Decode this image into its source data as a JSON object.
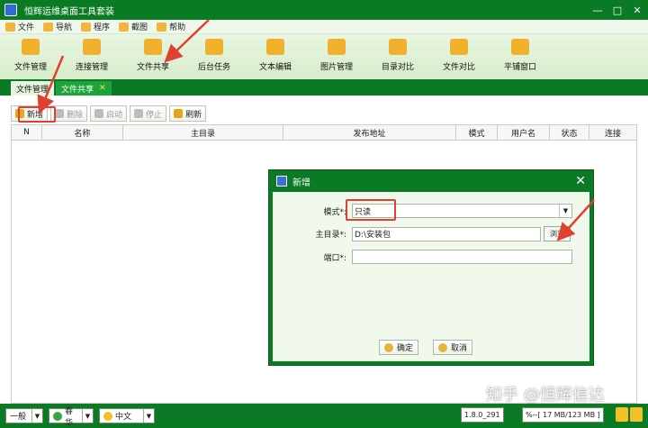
{
  "window": {
    "title": "恒辉运维桌面工具套装",
    "controls": [
      "—",
      "□",
      "✕"
    ]
  },
  "menu": [
    {
      "label": "文件",
      "icon": "file-icon"
    },
    {
      "label": "导航",
      "icon": "nav-icon"
    },
    {
      "label": "程序",
      "icon": "program-icon"
    },
    {
      "label": "截图",
      "icon": "crop-icon"
    },
    {
      "label": "帮助",
      "icon": "help-icon"
    }
  ],
  "toolbar": [
    {
      "label": "文件管理",
      "icon": "folder-icon"
    },
    {
      "label": "连接管理",
      "icon": "connect-icon"
    },
    {
      "label": "文件共享",
      "icon": "share-icon"
    },
    {
      "label": "后台任务",
      "icon": "monitor-icon"
    },
    {
      "label": "文本编辑",
      "icon": "edit-icon"
    },
    {
      "label": "图片管理",
      "icon": "image-icon"
    },
    {
      "label": "目录对比",
      "icon": "dir-compare-icon"
    },
    {
      "label": "文件对比",
      "icon": "file-compare-icon"
    },
    {
      "label": "平铺窗口",
      "icon": "tile-icon"
    }
  ],
  "tabs": [
    {
      "label": "文件管理",
      "active": false
    },
    {
      "label": "文件共享",
      "active": true,
      "close": "✕"
    }
  ],
  "actions": [
    {
      "label": "新增",
      "enabled": true,
      "color": "#e8a51c"
    },
    {
      "label": "删除",
      "enabled": false,
      "color": "#bdbdbd"
    },
    {
      "label": "启动",
      "enabled": false,
      "color": "#bdbdbd"
    },
    {
      "label": "停止",
      "enabled": false,
      "color": "#bdbdbd"
    },
    {
      "label": "刷新",
      "enabled": true,
      "color": "#e8a51c"
    }
  ],
  "table": {
    "columns": [
      "N",
      "名称",
      "主目录",
      "发布地址",
      "模式",
      "用户名",
      "状态",
      "连接"
    ]
  },
  "dialog": {
    "title": "新增",
    "close": "✕",
    "mode_label": "模式*:",
    "mode_value": "只读",
    "dir_label": "主目录*:",
    "dir_value": "D:\\安装包",
    "browse_label": "浏览",
    "port_label": "端口*:",
    "port_value": "",
    "ok_label": "确定",
    "cancel_label": "取消"
  },
  "status": {
    "level": "一般",
    "theme": "春华",
    "lang": "中文",
    "version": "1.8.0_291",
    "memory": "%--[ 17 MB/123 MB ]"
  },
  "watermark": "知乎 @恒辉信达",
  "colors": {
    "primary_green": "#0b7a24",
    "highlight_red": "#e04030"
  }
}
